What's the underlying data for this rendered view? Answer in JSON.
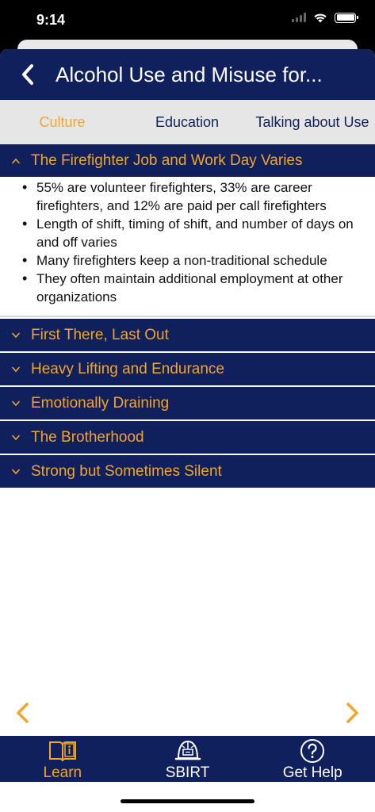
{
  "status_bar": {
    "time": "9:14"
  },
  "header": {
    "title": "Alcohol Use and Misuse for..."
  },
  "tabs": [
    {
      "label": "Culture",
      "active": true
    },
    {
      "label": "Education",
      "active": false
    },
    {
      "label": "Talking about Use",
      "active": false
    }
  ],
  "sections": [
    {
      "title": "The Firefighter Job and Work Day Varies",
      "expanded": true,
      "bullets": [
        "55% are volunteer firefighters, 33% are career firefighters, and 12% are paid per call firefighters",
        "Length of shift, timing of shift, and number of days on and off varies",
        "Many firefighters keep a non-traditional schedule",
        "They often maintain additional employment at other organizations"
      ]
    },
    {
      "title": "First There, Last Out",
      "expanded": false
    },
    {
      "title": "Heavy Lifting and Endurance",
      "expanded": false
    },
    {
      "title": "Emotionally Draining",
      "expanded": false
    },
    {
      "title": "The Brotherhood",
      "expanded": false
    },
    {
      "title": "Strong but Sometimes Silent",
      "expanded": false
    }
  ],
  "tabbar": {
    "items": [
      {
        "label": "Learn",
        "icon": "book-info-icon",
        "active": true
      },
      {
        "label": "SBIRT",
        "icon": "firefighter-helmet-icon",
        "active": false
      },
      {
        "label": "Get Help",
        "icon": "question-circle-icon",
        "active": false
      }
    ]
  },
  "colors": {
    "navy": "#10205c",
    "accent": "#f3a52a",
    "tab_bg": "#e6e6e6"
  }
}
